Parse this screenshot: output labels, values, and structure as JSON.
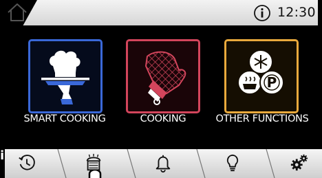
{
  "status_bar": {
    "time": "12:30",
    "home_icon": "home-icon",
    "info_icon": "info-icon"
  },
  "menu": {
    "tiles": [
      {
        "label": "SMART COOKING",
        "icon": "chef-hat-serving-tray-icon",
        "border_color": "#3a68d8"
      },
      {
        "label": "COOKING",
        "icon": "oven-mitt-icon",
        "border_color": "#d3455c"
      },
      {
        "label": "OTHER FUNCTIONS",
        "icon": "defrost-steam-pyrolysis-icon",
        "border_color": "#e9a93c"
      }
    ]
  },
  "bottom_bar": {
    "left_marker": "i",
    "items": [
      {
        "icon": "timer-clock-icon",
        "active": false
      },
      {
        "icon": "oven-menu-icon",
        "active": true
      },
      {
        "icon": "bell-icon",
        "active": false
      },
      {
        "icon": "lightbulb-icon",
        "active": false
      },
      {
        "icon": "gears-icon",
        "active": false
      }
    ]
  }
}
